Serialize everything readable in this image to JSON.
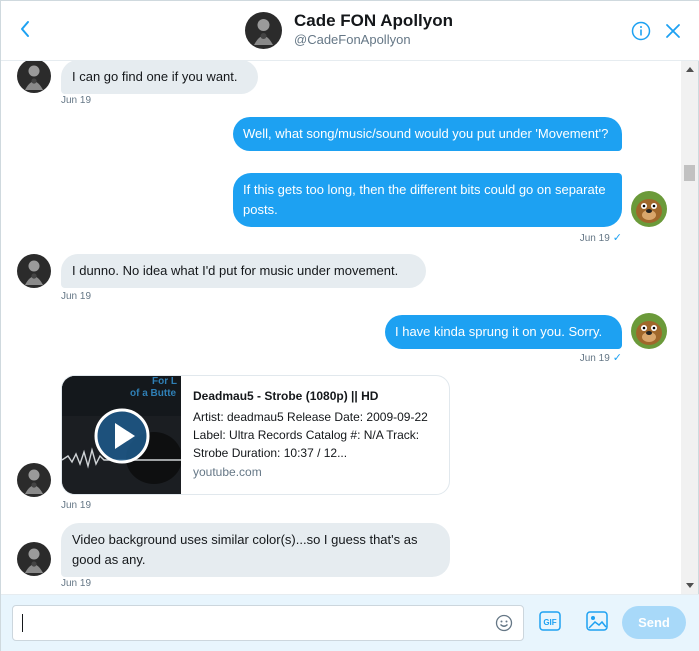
{
  "header": {
    "name": "Cade FON Apollyon",
    "handle": "@CadeFonApollyon"
  },
  "messages": [
    {
      "text": "I can go find one if you want.",
      "date": "Jun 19"
    },
    {
      "text1": "Well, what song/music/sound would you put under 'Movement'?",
      "text2": "If this gets too long, then the different bits could go on separate posts.",
      "date": "Jun 19"
    },
    {
      "text": "I dunno. No idea what I'd put for music under movement.",
      "date": "Jun 19"
    },
    {
      "text": "I have kinda sprung it on you. Sorry.",
      "date": "Jun 19"
    },
    {
      "date": "Jun 19"
    },
    {
      "text": "Video background uses similar color(s)...so I guess that's as good as any.",
      "date": "Jun 19"
    }
  ],
  "card": {
    "title": "Deadmau5 - Strobe (1080p) || HD",
    "description": "Artist: deadmau5 Release Date: 2009-09-22 Label: Ultra Records Catalog #: N/A Track: Strobe Duration: 10:37 / 12...",
    "domain": "youtube.com",
    "thumb_text": "For L of a Butte"
  },
  "composer": {
    "send_label": "Send",
    "gif_label": "GIF"
  },
  "colors": {
    "accent": "#1da1f2",
    "incoming_bubble": "#e6ecf0"
  },
  "icons": [
    "back-arrow-icon",
    "info-icon",
    "close-icon",
    "emoji-icon",
    "gif-icon",
    "image-icon",
    "play-icon",
    "read-check-icon"
  ]
}
